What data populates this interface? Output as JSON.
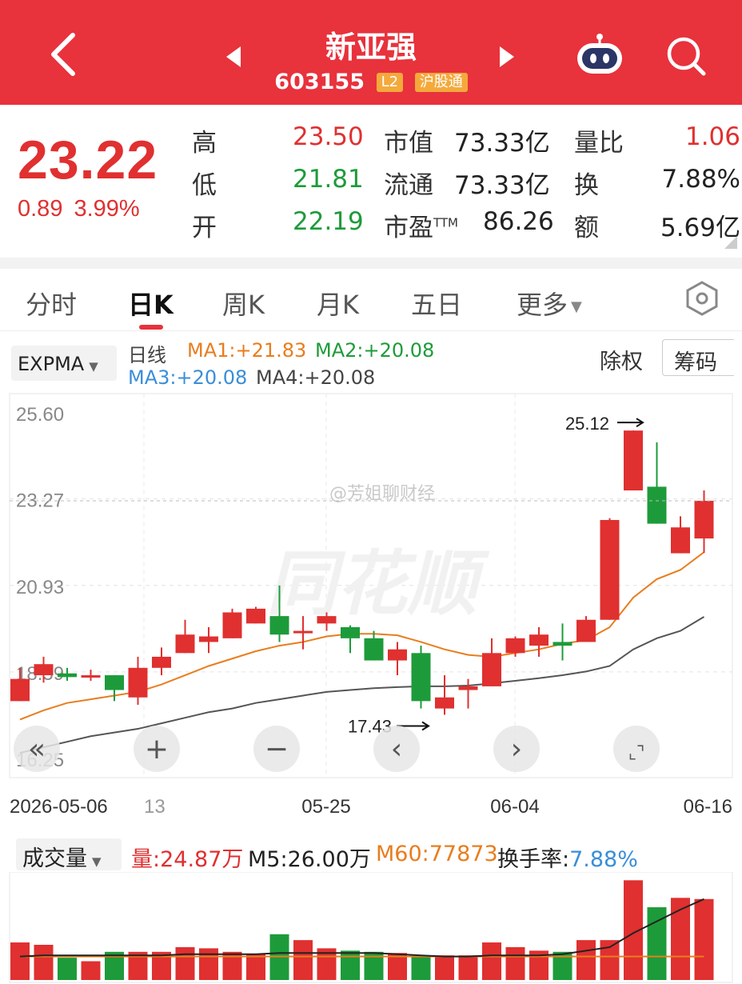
{
  "header": {
    "stock_name": "新亚强",
    "code": "603155",
    "badge_l2": "L2",
    "badge_connect": "沪股通"
  },
  "quote": {
    "price": "23.22",
    "change": "0.89",
    "change_pct": "3.99%",
    "high_label": "高",
    "high": "23.50",
    "low_label": "低",
    "low": "21.81",
    "open_label": "开",
    "open": "22.19",
    "mcap_label": "市值",
    "mcap": "73.33亿",
    "float_label": "流通",
    "float": "73.33亿",
    "pe_label": "市盈",
    "pe_sup": "TTM",
    "pe": "86.26",
    "volratio_label": "量比",
    "volratio": "1.06",
    "turnover_label": "换",
    "turnover": "7.88%",
    "amount_label": "额",
    "amount": "5.69亿"
  },
  "tabs": [
    "分时",
    "日K",
    "周K",
    "月K",
    "五日",
    "更多"
  ],
  "indicators": {
    "selector": "EXPMA",
    "period": "日线",
    "ma1": "MA1:+21.83",
    "ma2": "MA2:+20.08",
    "ma3": "MA3:+20.08",
    "ma4": "MA4:+20.08",
    "adjust": "除权",
    "chips": "筹码"
  },
  "chart_labels": {
    "high_marker": "25.12",
    "low_marker": "17.43",
    "watermark_brand": "同花顺",
    "watermark_user": "@芳姐聊财经"
  },
  "volume": {
    "selector": "成交量",
    "vol": "量:24.87万",
    "m5": "M5:26.00万",
    "m60": "M60:77873",
    "turnover_label": "换手率:",
    "turnover": "7.88%"
  },
  "colors": {
    "up": "#e03030",
    "down": "#1d9b3a",
    "header": "#e8323c"
  },
  "chart_data": {
    "type": "candlestick",
    "yticks": [
      "25.60",
      "23.27",
      "20.93",
      "18.59",
      "16.25"
    ],
    "ylim": [
      16.25,
      25.6
    ],
    "xticks": [
      "2026-05-06",
      "13",
      "05-25",
      "06-04",
      "06-16"
    ],
    "candles": [
      {
        "o": 17.8,
        "c": 18.4,
        "h": 18.7,
        "l": 17.8
      },
      {
        "o": 18.5,
        "c": 18.8,
        "h": 19.0,
        "l": 18.3
      },
      {
        "o": 18.55,
        "c": 18.45,
        "h": 18.7,
        "l": 18.35
      },
      {
        "o": 18.5,
        "c": 18.5,
        "h": 18.65,
        "l": 18.35
      },
      {
        "o": 18.5,
        "c": 18.1,
        "h": 18.5,
        "l": 17.8
      },
      {
        "o": 17.9,
        "c": 18.7,
        "h": 19.0,
        "l": 17.7
      },
      {
        "o": 18.7,
        "c": 19.0,
        "h": 19.25,
        "l": 18.5
      },
      {
        "o": 19.1,
        "c": 19.6,
        "h": 20.0,
        "l": 19.1
      },
      {
        "o": 19.4,
        "c": 19.55,
        "h": 19.8,
        "l": 19.1
      },
      {
        "o": 19.5,
        "c": 20.2,
        "h": 20.3,
        "l": 19.5
      },
      {
        "o": 19.9,
        "c": 20.3,
        "h": 20.35,
        "l": 19.9
      },
      {
        "o": 20.1,
        "c": 19.6,
        "h": 20.93,
        "l": 19.4
      },
      {
        "o": 19.7,
        "c": 19.7,
        "h": 20.1,
        "l": 19.2
      },
      {
        "o": 19.9,
        "c": 20.1,
        "h": 20.2,
        "l": 19.7
      },
      {
        "o": 19.8,
        "c": 19.5,
        "h": 19.85,
        "l": 19.1
      },
      {
        "o": 19.5,
        "c": 18.9,
        "h": 19.7,
        "l": 18.9
      },
      {
        "o": 18.9,
        "c": 19.2,
        "h": 19.4,
        "l": 18.5
      },
      {
        "o": 19.1,
        "c": 17.8,
        "h": 19.3,
        "l": 17.6
      },
      {
        "o": 17.6,
        "c": 17.9,
        "h": 18.5,
        "l": 17.43
      },
      {
        "o": 18.1,
        "c": 18.2,
        "h": 18.4,
        "l": 17.6
      },
      {
        "o": 18.2,
        "c": 19.1,
        "h": 19.5,
        "l": 18.2
      },
      {
        "o": 19.1,
        "c": 19.5,
        "h": 19.55,
        "l": 19.0
      },
      {
        "o": 19.3,
        "c": 19.6,
        "h": 19.8,
        "l": 19.0
      },
      {
        "o": 19.4,
        "c": 19.3,
        "h": 19.9,
        "l": 18.9
      },
      {
        "o": 19.4,
        "c": 20.0,
        "h": 20.1,
        "l": 19.4
      },
      {
        "o": 20.0,
        "c": 22.7,
        "h": 22.75,
        "l": 20.0
      },
      {
        "o": 23.5,
        "c": 25.12,
        "h": 25.12,
        "l": 23.5
      },
      {
        "o": 23.6,
        "c": 22.6,
        "h": 24.8,
        "l": 22.6
      },
      {
        "o": 21.8,
        "c": 22.5,
        "h": 22.8,
        "l": 21.8
      },
      {
        "o": 22.2,
        "c": 23.22,
        "h": 23.5,
        "l": 21.81
      }
    ],
    "ma1": [
      17.3,
      17.55,
      17.75,
      17.85,
      17.95,
      18.05,
      18.25,
      18.5,
      18.75,
      18.95,
      19.15,
      19.3,
      19.4,
      19.55,
      19.62,
      19.62,
      19.58,
      19.4,
      19.2,
      19.05,
      19.0,
      19.1,
      19.2,
      19.35,
      19.45,
      19.8,
      20.6,
      21.1,
      21.35,
      21.83
    ],
    "ma2": [
      16.4,
      16.55,
      16.7,
      16.85,
      16.95,
      17.05,
      17.2,
      17.35,
      17.5,
      17.6,
      17.75,
      17.85,
      17.95,
      18.05,
      18.1,
      18.15,
      18.18,
      18.2,
      18.2,
      18.22,
      18.28,
      18.35,
      18.42,
      18.5,
      18.6,
      18.75,
      19.2,
      19.5,
      19.7,
      20.08
    ],
    "volumes": [
      0.32,
      0.3,
      0.19,
      0.16,
      0.24,
      0.24,
      0.24,
      0.28,
      0.27,
      0.24,
      0.22,
      0.39,
      0.34,
      0.27,
      0.25,
      0.24,
      0.23,
      0.21,
      0.21,
      0.21,
      0.32,
      0.28,
      0.25,
      0.24,
      0.34,
      0.34,
      0.85,
      0.62,
      0.7,
      0.69
    ],
    "vol_ma5": [
      0.2,
      0.21,
      0.21,
      0.21,
      0.21,
      0.21,
      0.21,
      0.22,
      0.22,
      0.22,
      0.22,
      0.23,
      0.23,
      0.23,
      0.23,
      0.23,
      0.22,
      0.21,
      0.2,
      0.2,
      0.21,
      0.21,
      0.21,
      0.22,
      0.25,
      0.28,
      0.4,
      0.5,
      0.6,
      0.69
    ],
    "vol_ma60": [
      0.2,
      0.2,
      0.2,
      0.2,
      0.2,
      0.2,
      0.2,
      0.2,
      0.2,
      0.2,
      0.2,
      0.2,
      0.2,
      0.2,
      0.2,
      0.2,
      0.2,
      0.2,
      0.2,
      0.2,
      0.2,
      0.2,
      0.2,
      0.2,
      0.2,
      0.2,
      0.2,
      0.2,
      0.2,
      0.2
    ]
  }
}
